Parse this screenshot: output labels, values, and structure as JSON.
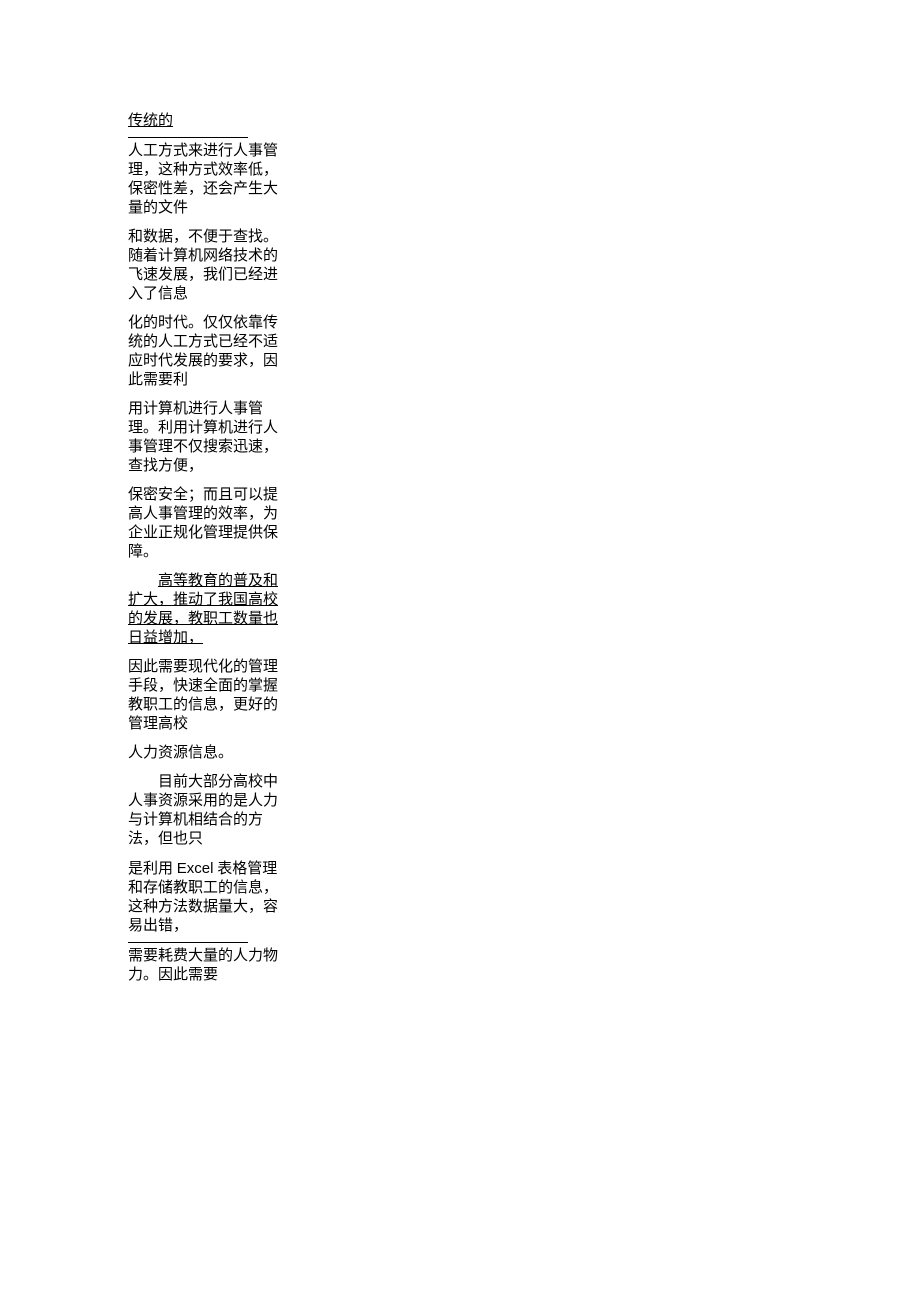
{
  "document": {
    "p1_lead": "传统的",
    "p2": "人工方式来进行人事管理，这种方式效率低，保密性差，还会产生大量的文件",
    "p3": "和数据，不便于查找。随着计算机网络技术的飞速发展，我们已经进入了信息",
    "p4": "化的时代。仅仅依靠传统的人工方式已经不适应时代发展的要求，因此需要利",
    "p5": "用计算机进行人事管理。利用计算机进行人事管理不仅搜索迅速，查找方便，",
    "p6": "保密安全；而且可以提高人事管理的效率，为企业正规化管理提供保障。",
    "p7": "高等教育的普及和扩大，推动了我国高校的发展，教职工数量也日益增加，",
    "p8": "因此需要现代化的管理手段，快速全面的掌握教职工的信息，更好的管理高校",
    "p9": "人力资源信息。",
    "p10": "目前大部分高校中人事资源采用的是人力与计算机相结合的方法，但也只",
    "p11_a": "是利用 ",
    "p11_b": "Excel",
    "p11_c": " 表格管理和存储教职工的信息，这种方法数据量大，容易出错，",
    "p12": "需要耗费大量的人力物力。因此需要"
  }
}
